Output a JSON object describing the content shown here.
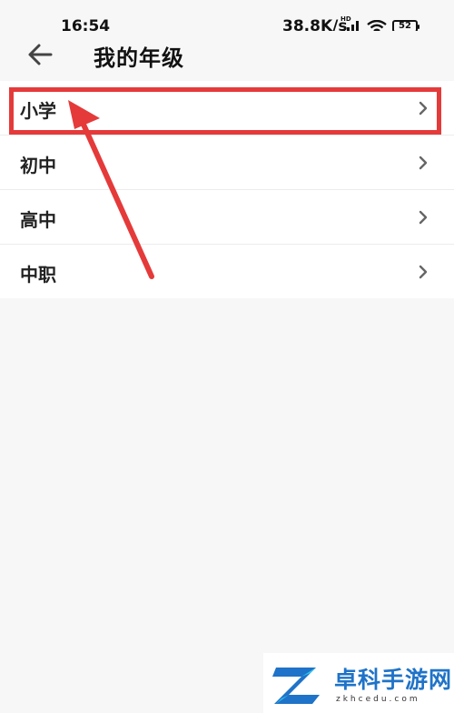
{
  "status_bar": {
    "time": "16:54",
    "network_speed": "38.8K/s",
    "hd_label": "HD",
    "battery_level": "52",
    "icons": [
      "signal-icon",
      "wifi-icon",
      "battery-icon"
    ]
  },
  "header": {
    "title": "我的年级",
    "back_icon": "arrow-left-icon"
  },
  "grade_list": {
    "items": [
      {
        "label": "小学"
      },
      {
        "label": "初中"
      },
      {
        "label": "高中"
      },
      {
        "label": "中职"
      }
    ],
    "item_icon": "chevron-right-icon"
  },
  "annotation": {
    "color": "#e53a3a",
    "highlighted_item": "小学"
  },
  "watermark": {
    "brand": "卓科手游网",
    "domain": "zkhcedu.com",
    "color": "#1f73c8"
  },
  "colors": {
    "background": "#f7f7f7",
    "list_background": "#ffffff",
    "divider": "#ececec"
  }
}
